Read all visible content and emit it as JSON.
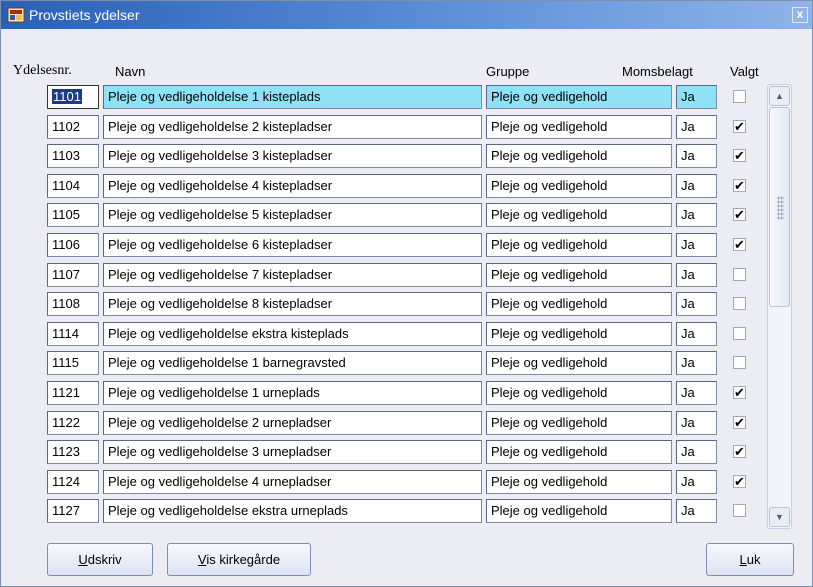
{
  "window": {
    "title": "Provstiets ydelser",
    "close_label": "x"
  },
  "columns": {
    "nr": "Ydelsesnr.",
    "name": "Navn",
    "group": "Gruppe",
    "moms": "Momsbelagt",
    "valgt": "Valgt"
  },
  "rows": [
    {
      "nr": "1101",
      "name": "Pleje og vedligeholdelse 1 kisteplads",
      "group": "Pleje og vedligehold",
      "moms": "Ja",
      "valgt": false
    },
    {
      "nr": "1102",
      "name": "Pleje og vedligeholdelse 2 kistepladser",
      "group": "Pleje og vedligehold",
      "moms": "Ja",
      "valgt": true
    },
    {
      "nr": "1103",
      "name": "Pleje og vedligeholdelse 3 kistepladser",
      "group": "Pleje og vedligehold",
      "moms": "Ja",
      "valgt": true
    },
    {
      "nr": "1104",
      "name": "Pleje og vedligeholdelse 4 kistepladser",
      "group": "Pleje og vedligehold",
      "moms": "Ja",
      "valgt": true
    },
    {
      "nr": "1105",
      "name": "Pleje og vedligeholdelse 5 kistepladser",
      "group": "Pleje og vedligehold",
      "moms": "Ja",
      "valgt": true
    },
    {
      "nr": "1106",
      "name": "Pleje og vedligeholdelse 6 kistepladser",
      "group": "Pleje og vedligehold",
      "moms": "Ja",
      "valgt": true
    },
    {
      "nr": "1107",
      "name": "Pleje og vedligeholdelse 7 kistepladser",
      "group": "Pleje og vedligehold",
      "moms": "Ja",
      "valgt": false
    },
    {
      "nr": "1108",
      "name": "Pleje og vedligeholdelse 8 kistepladser",
      "group": "Pleje og vedligehold",
      "moms": "Ja",
      "valgt": false
    },
    {
      "nr": "1114",
      "name": "Pleje og vedligeholdelse ekstra kisteplads",
      "group": "Pleje og vedligehold",
      "moms": "Ja",
      "valgt": false
    },
    {
      "nr": "1115",
      "name": "Pleje og vedligeholdelse 1 barnegravsted",
      "group": "Pleje og vedligehold",
      "moms": "Ja",
      "valgt": false
    },
    {
      "nr": "1121",
      "name": "Pleje og vedligeholdelse 1 urneplads",
      "group": "Pleje og vedligehold",
      "moms": "Ja",
      "valgt": true
    },
    {
      "nr": "1122",
      "name": "Pleje og vedligeholdelse 2 urnepladser",
      "group": "Pleje og vedligehold",
      "moms": "Ja",
      "valgt": true
    },
    {
      "nr": "1123",
      "name": "Pleje og vedligeholdelse 3 urnepladser",
      "group": "Pleje og vedligehold",
      "moms": "Ja",
      "valgt": true
    },
    {
      "nr": "1124",
      "name": "Pleje og vedligeholdelse 4 urnepladser",
      "group": "Pleje og vedligehold",
      "moms": "Ja",
      "valgt": true
    },
    {
      "nr": "1127",
      "name": "Pleje og vedligeholdelse ekstra urneplads",
      "group": "Pleje og vedligehold",
      "moms": "Ja",
      "valgt": false
    }
  ],
  "check_glyph": "✔",
  "buttons": {
    "print_accel": "U",
    "print_rest": "dskriv",
    "cemeteries_accel": "V",
    "cemeteries_rest": "is kirkegårde",
    "close_accel": "L",
    "close_rest": "uk"
  },
  "icons": {
    "app": "app-form-icon",
    "scroll_up": "scroll-up-arrow-icon",
    "scroll_down": "scroll-down-arrow-icon"
  },
  "colors": {
    "title_start": "#2a5fb8",
    "title_end": "#8fb4e8",
    "current_row": "#8fe2f5",
    "selection": "#1b3a8a",
    "window_bg": "#ececf5"
  }
}
